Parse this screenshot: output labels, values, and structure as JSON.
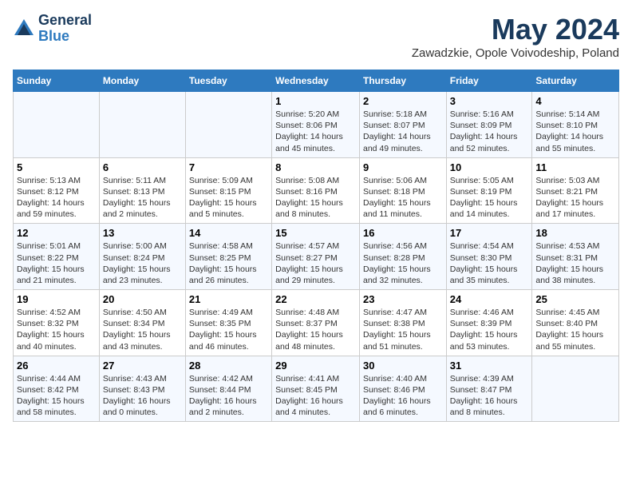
{
  "header": {
    "logo_general": "General",
    "logo_blue": "Blue",
    "month_title": "May 2024",
    "subtitle": "Zawadzkie, Opole Voivodeship, Poland"
  },
  "columns": [
    "Sunday",
    "Monday",
    "Tuesday",
    "Wednesday",
    "Thursday",
    "Friday",
    "Saturday"
  ],
  "weeks": [
    [
      {
        "day": "",
        "info": ""
      },
      {
        "day": "",
        "info": ""
      },
      {
        "day": "",
        "info": ""
      },
      {
        "day": "1",
        "info": "Sunrise: 5:20 AM\nSunset: 8:06 PM\nDaylight: 14 hours\nand 45 minutes."
      },
      {
        "day": "2",
        "info": "Sunrise: 5:18 AM\nSunset: 8:07 PM\nDaylight: 14 hours\nand 49 minutes."
      },
      {
        "day": "3",
        "info": "Sunrise: 5:16 AM\nSunset: 8:09 PM\nDaylight: 14 hours\nand 52 minutes."
      },
      {
        "day": "4",
        "info": "Sunrise: 5:14 AM\nSunset: 8:10 PM\nDaylight: 14 hours\nand 55 minutes."
      }
    ],
    [
      {
        "day": "5",
        "info": "Sunrise: 5:13 AM\nSunset: 8:12 PM\nDaylight: 14 hours\nand 59 minutes."
      },
      {
        "day": "6",
        "info": "Sunrise: 5:11 AM\nSunset: 8:13 PM\nDaylight: 15 hours\nand 2 minutes."
      },
      {
        "day": "7",
        "info": "Sunrise: 5:09 AM\nSunset: 8:15 PM\nDaylight: 15 hours\nand 5 minutes."
      },
      {
        "day": "8",
        "info": "Sunrise: 5:08 AM\nSunset: 8:16 PM\nDaylight: 15 hours\nand 8 minutes."
      },
      {
        "day": "9",
        "info": "Sunrise: 5:06 AM\nSunset: 8:18 PM\nDaylight: 15 hours\nand 11 minutes."
      },
      {
        "day": "10",
        "info": "Sunrise: 5:05 AM\nSunset: 8:19 PM\nDaylight: 15 hours\nand 14 minutes."
      },
      {
        "day": "11",
        "info": "Sunrise: 5:03 AM\nSunset: 8:21 PM\nDaylight: 15 hours\nand 17 minutes."
      }
    ],
    [
      {
        "day": "12",
        "info": "Sunrise: 5:01 AM\nSunset: 8:22 PM\nDaylight: 15 hours\nand 21 minutes."
      },
      {
        "day": "13",
        "info": "Sunrise: 5:00 AM\nSunset: 8:24 PM\nDaylight: 15 hours\nand 23 minutes."
      },
      {
        "day": "14",
        "info": "Sunrise: 4:58 AM\nSunset: 8:25 PM\nDaylight: 15 hours\nand 26 minutes."
      },
      {
        "day": "15",
        "info": "Sunrise: 4:57 AM\nSunset: 8:27 PM\nDaylight: 15 hours\nand 29 minutes."
      },
      {
        "day": "16",
        "info": "Sunrise: 4:56 AM\nSunset: 8:28 PM\nDaylight: 15 hours\nand 32 minutes."
      },
      {
        "day": "17",
        "info": "Sunrise: 4:54 AM\nSunset: 8:30 PM\nDaylight: 15 hours\nand 35 minutes."
      },
      {
        "day": "18",
        "info": "Sunrise: 4:53 AM\nSunset: 8:31 PM\nDaylight: 15 hours\nand 38 minutes."
      }
    ],
    [
      {
        "day": "19",
        "info": "Sunrise: 4:52 AM\nSunset: 8:32 PM\nDaylight: 15 hours\nand 40 minutes."
      },
      {
        "day": "20",
        "info": "Sunrise: 4:50 AM\nSunset: 8:34 PM\nDaylight: 15 hours\nand 43 minutes."
      },
      {
        "day": "21",
        "info": "Sunrise: 4:49 AM\nSunset: 8:35 PM\nDaylight: 15 hours\nand 46 minutes."
      },
      {
        "day": "22",
        "info": "Sunrise: 4:48 AM\nSunset: 8:37 PM\nDaylight: 15 hours\nand 48 minutes."
      },
      {
        "day": "23",
        "info": "Sunrise: 4:47 AM\nSunset: 8:38 PM\nDaylight: 15 hours\nand 51 minutes."
      },
      {
        "day": "24",
        "info": "Sunrise: 4:46 AM\nSunset: 8:39 PM\nDaylight: 15 hours\nand 53 minutes."
      },
      {
        "day": "25",
        "info": "Sunrise: 4:45 AM\nSunset: 8:40 PM\nDaylight: 15 hours\nand 55 minutes."
      }
    ],
    [
      {
        "day": "26",
        "info": "Sunrise: 4:44 AM\nSunset: 8:42 PM\nDaylight: 15 hours\nand 58 minutes."
      },
      {
        "day": "27",
        "info": "Sunrise: 4:43 AM\nSunset: 8:43 PM\nDaylight: 16 hours\nand 0 minutes."
      },
      {
        "day": "28",
        "info": "Sunrise: 4:42 AM\nSunset: 8:44 PM\nDaylight: 16 hours\nand 2 minutes."
      },
      {
        "day": "29",
        "info": "Sunrise: 4:41 AM\nSunset: 8:45 PM\nDaylight: 16 hours\nand 4 minutes."
      },
      {
        "day": "30",
        "info": "Sunrise: 4:40 AM\nSunset: 8:46 PM\nDaylight: 16 hours\nand 6 minutes."
      },
      {
        "day": "31",
        "info": "Sunrise: 4:39 AM\nSunset: 8:47 PM\nDaylight: 16 hours\nand 8 minutes."
      },
      {
        "day": "",
        "info": ""
      }
    ]
  ]
}
